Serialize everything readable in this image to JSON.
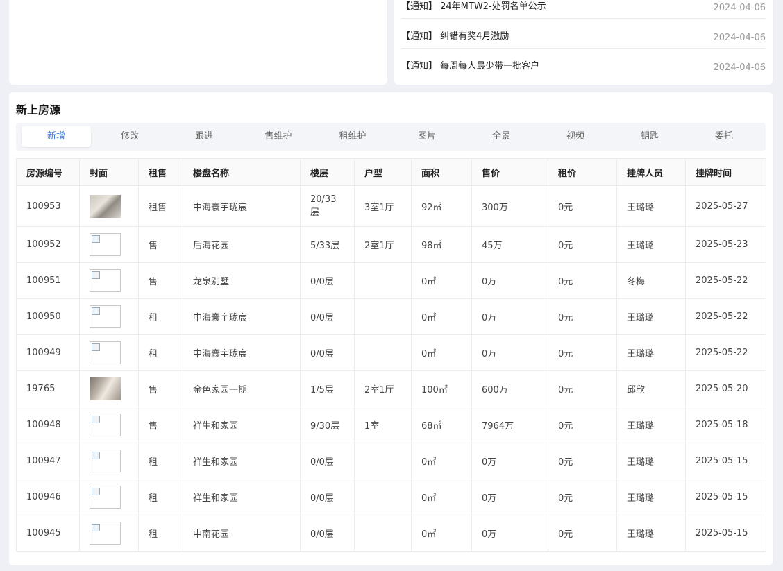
{
  "notices": [
    {
      "text": "【通知】 24年MTW2-处罚名单公示",
      "date": "2024-04-06"
    },
    {
      "text": "【通知】 纠错有奖4月激励",
      "date": "2024-04-06"
    },
    {
      "text": "【通知】 每周每人最少带一批客户",
      "date": "2024-04-06"
    }
  ],
  "listing": {
    "title": "新上房源",
    "tabs": [
      "新增",
      "修改",
      "跟进",
      "售维护",
      "租维护",
      "图片",
      "全景",
      "视频",
      "钥匙",
      "委托"
    ],
    "active_tab": "新增",
    "columns": [
      "房源编号",
      "封面",
      "租售",
      "楼盘名称",
      "楼层",
      "户型",
      "面积",
      "售价",
      "租价",
      "挂牌人员",
      "挂牌时间"
    ],
    "rows": [
      {
        "id": "100953",
        "cover": "photo",
        "type": "租售",
        "estate": "中海寰宇珑宸",
        "floor": "20/33层",
        "layout": "3室1厅",
        "area": "92㎡",
        "price": "300万",
        "rent": "0元",
        "agent": "王璐璐",
        "date": "2025-05-27"
      },
      {
        "id": "100952",
        "cover": "broken",
        "type": "售",
        "estate": "后海花园",
        "floor": "5/33层",
        "layout": "2室1厅",
        "area": "98㎡",
        "price": "45万",
        "rent": "0元",
        "agent": "王璐璐",
        "date": "2025-05-23"
      },
      {
        "id": "100951",
        "cover": "broken",
        "type": "售",
        "estate": "龙泉别墅",
        "floor": "0/0层",
        "layout": "",
        "area": "0㎡",
        "price": "0万",
        "rent": "0元",
        "agent": "冬梅",
        "date": "2025-05-22"
      },
      {
        "id": "100950",
        "cover": "broken",
        "type": "租",
        "estate": "中海寰宇珑宸",
        "floor": "0/0层",
        "layout": "",
        "area": "0㎡",
        "price": "0万",
        "rent": "0元",
        "agent": "王璐璐",
        "date": "2025-05-22"
      },
      {
        "id": "100949",
        "cover": "broken",
        "type": "租",
        "estate": "中海寰宇珑宸",
        "floor": "0/0层",
        "layout": "",
        "area": "0㎡",
        "price": "0万",
        "rent": "0元",
        "agent": "王璐璐",
        "date": "2025-05-22"
      },
      {
        "id": "19765",
        "cover": "photo",
        "type": "售",
        "estate": "金色家园一期",
        "floor": "1/5层",
        "layout": "2室1厅",
        "area": "100㎡",
        "price": "600万",
        "rent": "0元",
        "agent": "邱欣",
        "date": "2025-05-20"
      },
      {
        "id": "100948",
        "cover": "broken",
        "type": "售",
        "estate": "祥生和家园",
        "floor": "9/30层",
        "layout": "1室",
        "area": "68㎡",
        "price": "7964万",
        "rent": "0元",
        "agent": "王璐璐",
        "date": "2025-05-18"
      },
      {
        "id": "100947",
        "cover": "broken",
        "type": "租",
        "estate": "祥生和家园",
        "floor": "0/0层",
        "layout": "",
        "area": "0㎡",
        "price": "0万",
        "rent": "0元",
        "agent": "王璐璐",
        "date": "2025-05-15"
      },
      {
        "id": "100946",
        "cover": "broken",
        "type": "租",
        "estate": "祥生和家园",
        "floor": "0/0层",
        "layout": "",
        "area": "0㎡",
        "price": "0万",
        "rent": "0元",
        "agent": "王璐璐",
        "date": "2025-05-15"
      },
      {
        "id": "100945",
        "cover": "broken",
        "type": "租",
        "estate": "中南花园",
        "floor": "0/0层",
        "layout": "",
        "area": "0㎡",
        "price": "0万",
        "rent": "0元",
        "agent": "王璐璐",
        "date": "2025-05-15"
      }
    ]
  }
}
